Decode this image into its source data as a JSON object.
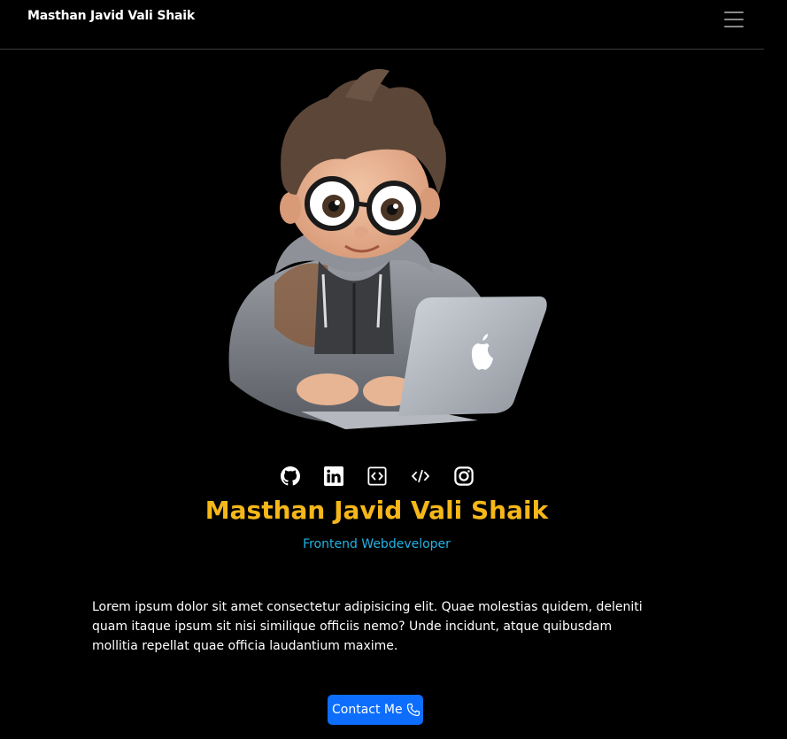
{
  "navbar": {
    "brand": "Masthan Javid Vali Shaik"
  },
  "hero": {
    "social_icons": [
      "github-icon",
      "linkedin-icon",
      "code-box-icon",
      "code-slash-icon",
      "instagram-icon"
    ],
    "name": "Masthan Javid Vali Shaik",
    "role": "Frontend Webdeveloper",
    "about": "Lorem ipsum dolor sit amet consectetur adipisicing elit. Quae molestias quidem, deleniti quam itaque ipsum sit nisi similique officiis nemo? Unde incidunt, atque quibusdam mollitia repellat quae officia laudantium maxime.",
    "contact_label": "Contact Me"
  },
  "colors": {
    "background": "#000000",
    "name": "#f5b719",
    "role": "#22b4e6",
    "button": "#0d6efd"
  }
}
